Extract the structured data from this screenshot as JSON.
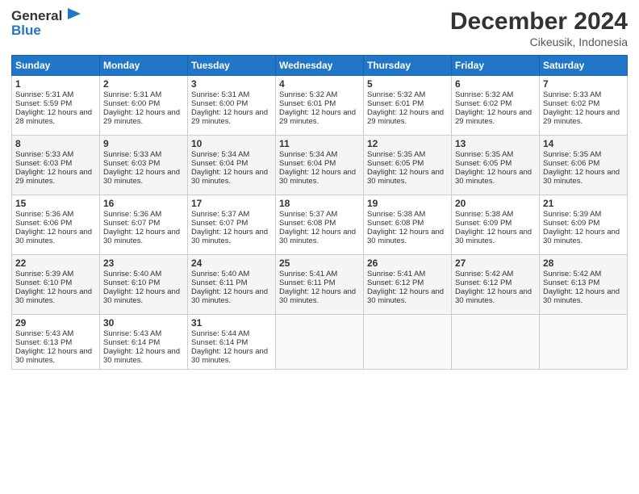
{
  "header": {
    "logo_general": "General",
    "logo_blue": "Blue",
    "month": "December 2024",
    "location": "Cikeusik, Indonesia"
  },
  "weekdays": [
    "Sunday",
    "Monday",
    "Tuesday",
    "Wednesday",
    "Thursday",
    "Friday",
    "Saturday"
  ],
  "weeks": [
    [
      {
        "day": "1",
        "sunrise": "5:31 AM",
        "sunset": "5:59 PM",
        "daylight": "12 hours and 28 minutes."
      },
      {
        "day": "2",
        "sunrise": "5:31 AM",
        "sunset": "6:00 PM",
        "daylight": "12 hours and 29 minutes."
      },
      {
        "day": "3",
        "sunrise": "5:31 AM",
        "sunset": "6:00 PM",
        "daylight": "12 hours and 29 minutes."
      },
      {
        "day": "4",
        "sunrise": "5:32 AM",
        "sunset": "6:01 PM",
        "daylight": "12 hours and 29 minutes."
      },
      {
        "day": "5",
        "sunrise": "5:32 AM",
        "sunset": "6:01 PM",
        "daylight": "12 hours and 29 minutes."
      },
      {
        "day": "6",
        "sunrise": "5:32 AM",
        "sunset": "6:02 PM",
        "daylight": "12 hours and 29 minutes."
      },
      {
        "day": "7",
        "sunrise": "5:33 AM",
        "sunset": "6:02 PM",
        "daylight": "12 hours and 29 minutes."
      }
    ],
    [
      {
        "day": "8",
        "sunrise": "5:33 AM",
        "sunset": "6:03 PM",
        "daylight": "12 hours and 29 minutes."
      },
      {
        "day": "9",
        "sunrise": "5:33 AM",
        "sunset": "6:03 PM",
        "daylight": "12 hours and 30 minutes."
      },
      {
        "day": "10",
        "sunrise": "5:34 AM",
        "sunset": "6:04 PM",
        "daylight": "12 hours and 30 minutes."
      },
      {
        "day": "11",
        "sunrise": "5:34 AM",
        "sunset": "6:04 PM",
        "daylight": "12 hours and 30 minutes."
      },
      {
        "day": "12",
        "sunrise": "5:35 AM",
        "sunset": "6:05 PM",
        "daylight": "12 hours and 30 minutes."
      },
      {
        "day": "13",
        "sunrise": "5:35 AM",
        "sunset": "6:05 PM",
        "daylight": "12 hours and 30 minutes."
      },
      {
        "day": "14",
        "sunrise": "5:35 AM",
        "sunset": "6:06 PM",
        "daylight": "12 hours and 30 minutes."
      }
    ],
    [
      {
        "day": "15",
        "sunrise": "5:36 AM",
        "sunset": "6:06 PM",
        "daylight": "12 hours and 30 minutes."
      },
      {
        "day": "16",
        "sunrise": "5:36 AM",
        "sunset": "6:07 PM",
        "daylight": "12 hours and 30 minutes."
      },
      {
        "day": "17",
        "sunrise": "5:37 AM",
        "sunset": "6:07 PM",
        "daylight": "12 hours and 30 minutes."
      },
      {
        "day": "18",
        "sunrise": "5:37 AM",
        "sunset": "6:08 PM",
        "daylight": "12 hours and 30 minutes."
      },
      {
        "day": "19",
        "sunrise": "5:38 AM",
        "sunset": "6:08 PM",
        "daylight": "12 hours and 30 minutes."
      },
      {
        "day": "20",
        "sunrise": "5:38 AM",
        "sunset": "6:09 PM",
        "daylight": "12 hours and 30 minutes."
      },
      {
        "day": "21",
        "sunrise": "5:39 AM",
        "sunset": "6:09 PM",
        "daylight": "12 hours and 30 minutes."
      }
    ],
    [
      {
        "day": "22",
        "sunrise": "5:39 AM",
        "sunset": "6:10 PM",
        "daylight": "12 hours and 30 minutes."
      },
      {
        "day": "23",
        "sunrise": "5:40 AM",
        "sunset": "6:10 PM",
        "daylight": "12 hours and 30 minutes."
      },
      {
        "day": "24",
        "sunrise": "5:40 AM",
        "sunset": "6:11 PM",
        "daylight": "12 hours and 30 minutes."
      },
      {
        "day": "25",
        "sunrise": "5:41 AM",
        "sunset": "6:11 PM",
        "daylight": "12 hours and 30 minutes."
      },
      {
        "day": "26",
        "sunrise": "5:41 AM",
        "sunset": "6:12 PM",
        "daylight": "12 hours and 30 minutes."
      },
      {
        "day": "27",
        "sunrise": "5:42 AM",
        "sunset": "6:12 PM",
        "daylight": "12 hours and 30 minutes."
      },
      {
        "day": "28",
        "sunrise": "5:42 AM",
        "sunset": "6:13 PM",
        "daylight": "12 hours and 30 minutes."
      }
    ],
    [
      {
        "day": "29",
        "sunrise": "5:43 AM",
        "sunset": "6:13 PM",
        "daylight": "12 hours and 30 minutes."
      },
      {
        "day": "30",
        "sunrise": "5:43 AM",
        "sunset": "6:14 PM",
        "daylight": "12 hours and 30 minutes."
      },
      {
        "day": "31",
        "sunrise": "5:44 AM",
        "sunset": "6:14 PM",
        "daylight": "12 hours and 30 minutes."
      },
      null,
      null,
      null,
      null
    ]
  ]
}
